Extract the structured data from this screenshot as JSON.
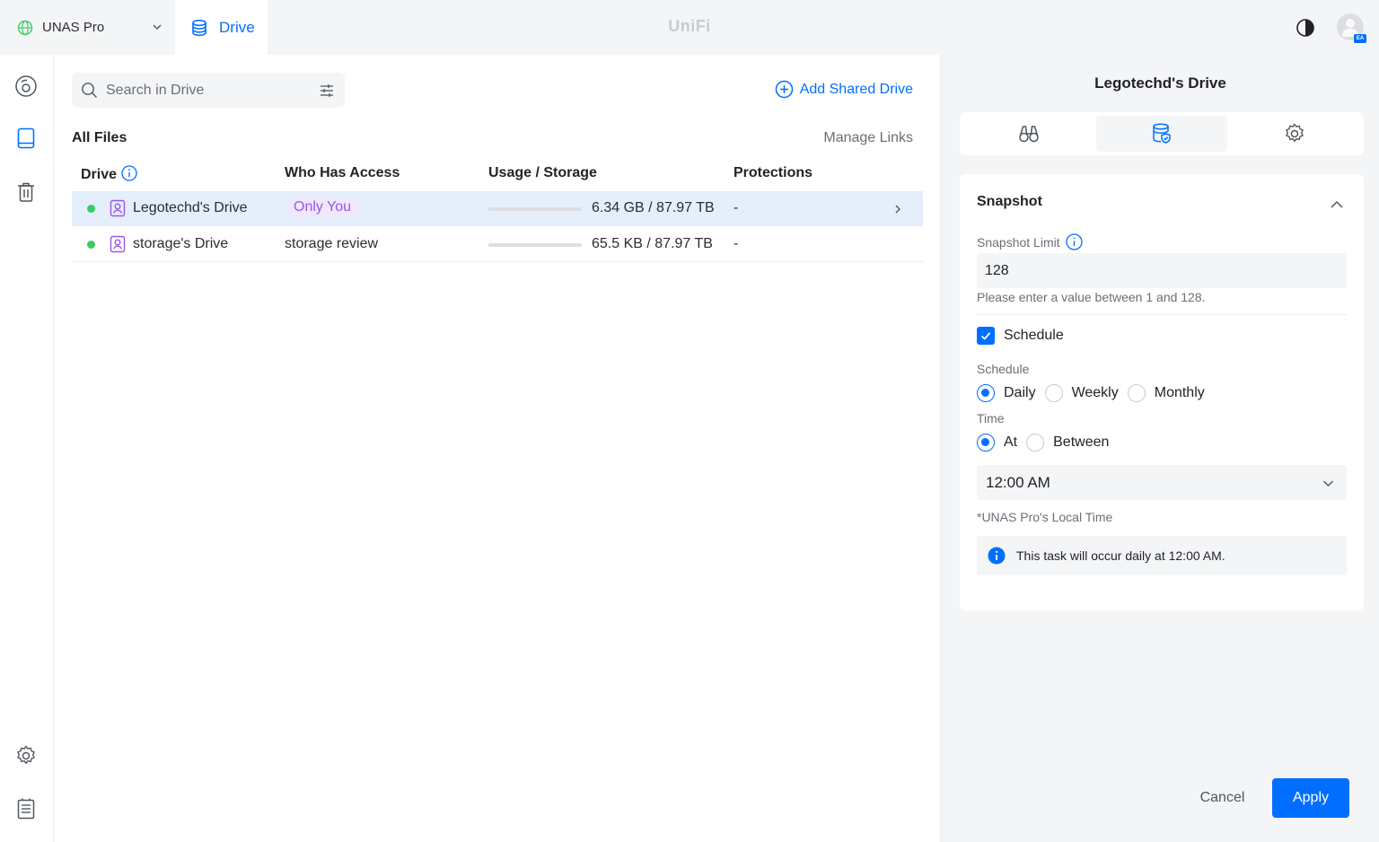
{
  "topbar": {
    "device_name": "UNAS Pro",
    "app_tab_label": "Drive",
    "brand": "UniFi",
    "avatar_badge": "EA"
  },
  "leftnav": {
    "items": [
      "dashboard-icon",
      "drive-icon",
      "trash-icon",
      "settings-icon",
      "logs-icon"
    ]
  },
  "main": {
    "search_placeholder": "Search in Drive",
    "add_shared_drive": "Add Shared Drive",
    "section_title": "All Files",
    "manage_links": "Manage Links",
    "columns": {
      "drive": "Drive",
      "access": "Who Has Access",
      "usage": "Usage / Storage",
      "protections": "Protections"
    },
    "rows": [
      {
        "name": "Legotechd's Drive",
        "access": "Only You",
        "access_style": "pill",
        "usage": "6.34 GB / 87.97 TB",
        "usage_fraction": 0.0001,
        "protections": "-",
        "status": "online",
        "selected": true
      },
      {
        "name": "storage's Drive",
        "access": "storage review",
        "access_style": "text",
        "usage": "65.5 KB / 87.97 TB",
        "usage_fraction": 0.0,
        "protections": "-",
        "status": "online",
        "selected": false
      }
    ]
  },
  "panel": {
    "title": "Legotechd's Drive",
    "tabs": [
      "binoculars-icon",
      "database-shield-icon",
      "gear-icon"
    ],
    "active_tab": 1,
    "snapshot": {
      "title": "Snapshot",
      "limit_label": "Snapshot Limit",
      "limit_value": "128",
      "limit_hint": "Please enter a value between 1 and 128.",
      "schedule_checkbox_label": "Schedule",
      "schedule_checked": true,
      "schedule_label": "Schedule",
      "schedule_options": [
        "Daily",
        "Weekly",
        "Monthly"
      ],
      "schedule_selected": "Daily",
      "time_label": "Time",
      "time_options": [
        "At",
        "Between"
      ],
      "time_selected": "At",
      "time_value": "12:00 AM",
      "local_time_note": "*UNAS Pro's Local Time",
      "info_text": "This task will occur daily at 12:00 AM."
    },
    "cancel_label": "Cancel",
    "apply_label": "Apply"
  },
  "colors": {
    "accent": "#006fff",
    "online": "#39cc63",
    "pill_bg": "#efe7fb",
    "pill_text": "#9658e8",
    "selected_row": "#e5eefb"
  }
}
